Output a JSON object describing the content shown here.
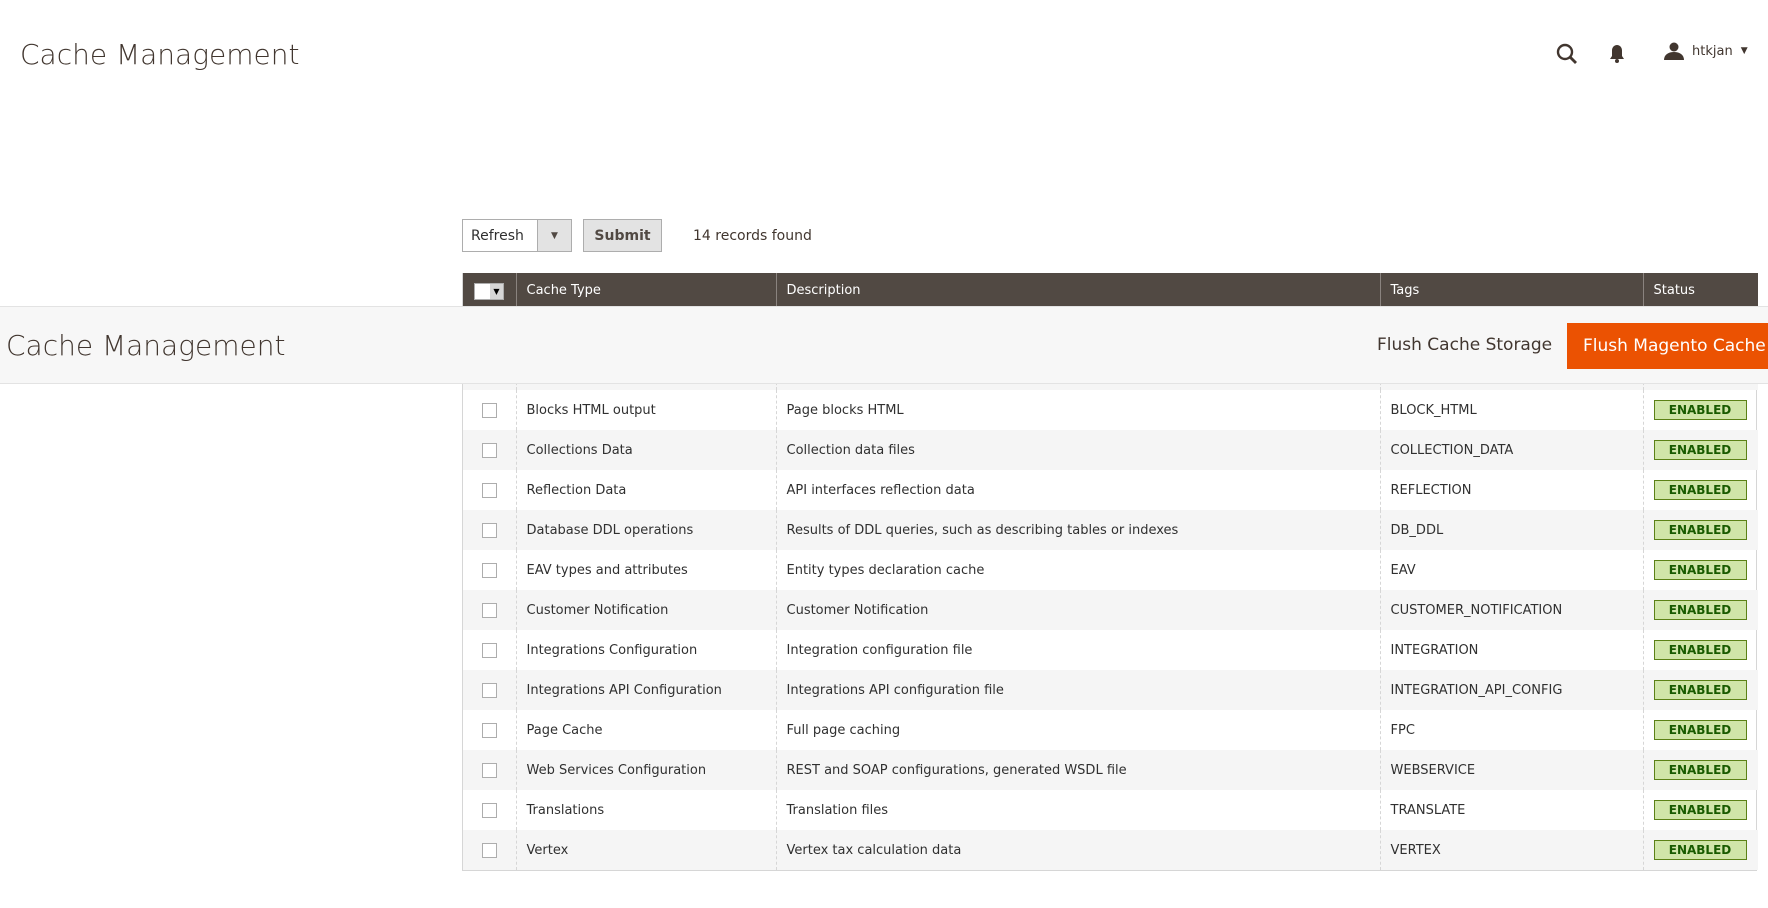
{
  "header": {
    "title": "Cache Management",
    "username": "htkjan",
    "icons": [
      "search-icon",
      "bell-icon",
      "user-icon",
      "caret-down-icon"
    ]
  },
  "toolbar": {
    "action_value": "Refresh",
    "submit_label": "Submit",
    "records": "14 records found"
  },
  "grid": {
    "columns": [
      "Cache Type",
      "Description",
      "Tags",
      "Status"
    ],
    "rows": [
      {
        "type": "Blocks HTML output",
        "desc": "Page blocks HTML",
        "tags": "BLOCK_HTML",
        "status": "ENABLED"
      },
      {
        "type": "Collections Data",
        "desc": "Collection data files",
        "tags": "COLLECTION_DATA",
        "status": "ENABLED"
      },
      {
        "type": "Reflection Data",
        "desc": "API interfaces reflection data",
        "tags": "REFLECTION",
        "status": "ENABLED"
      },
      {
        "type": "Database DDL operations",
        "desc": "Results of DDL queries, such as describing tables or indexes",
        "tags": "DB_DDL",
        "status": "ENABLED"
      },
      {
        "type": "EAV types and attributes",
        "desc": "Entity types declaration cache",
        "tags": "EAV",
        "status": "ENABLED"
      },
      {
        "type": "Customer Notification",
        "desc": "Customer Notification",
        "tags": "CUSTOMER_NOTIFICATION",
        "status": "ENABLED"
      },
      {
        "type": "Integrations Configuration",
        "desc": "Integration configuration file",
        "tags": "INTEGRATION",
        "status": "ENABLED"
      },
      {
        "type": "Integrations API Configuration",
        "desc": "Integrations API configuration file",
        "tags": "INTEGRATION_API_CONFIG",
        "status": "ENABLED"
      },
      {
        "type": "Page Cache",
        "desc": "Full page caching",
        "tags": "FPC",
        "status": "ENABLED"
      },
      {
        "type": "Web Services Configuration",
        "desc": "REST and SOAP configurations, generated WSDL file",
        "tags": "WEBSERVICE",
        "status": "ENABLED"
      },
      {
        "type": "Translations",
        "desc": "Translation files",
        "tags": "TRANSLATE",
        "status": "ENABLED"
      },
      {
        "type": "Vertex",
        "desc": "Vertex tax calculation data",
        "tags": "VERTEX",
        "status": "ENABLED"
      }
    ]
  },
  "sticky": {
    "title": "Cache Management",
    "flush_storage": "Flush Cache Storage",
    "flush_magento": "Flush Magento Cache"
  },
  "colors": {
    "accent": "#eb5202",
    "header_bg": "#514943",
    "enabled_bg": "#d0e5a9",
    "enabled_text": "#185b00"
  }
}
